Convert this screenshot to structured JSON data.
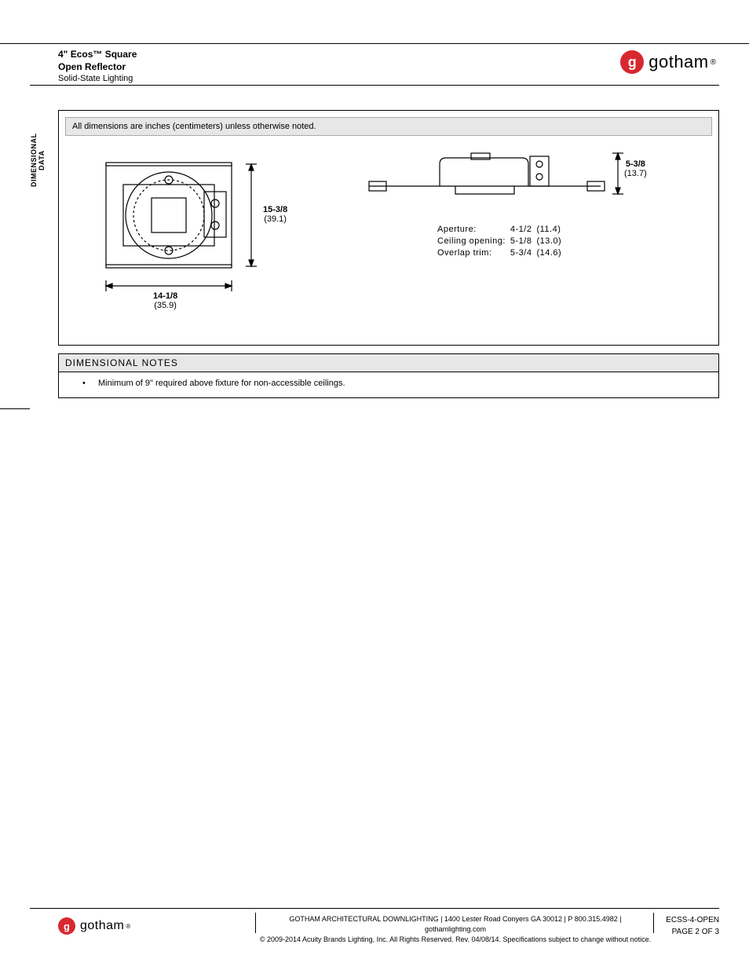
{
  "header": {
    "line1": "4\" Ecos™ Square",
    "line2": "Open Reflector",
    "line3": "Solid-State Lighting"
  },
  "brand": {
    "name": "gotham",
    "reg": "®"
  },
  "side_tab": "DIMENSIONAL DATA",
  "dim_note": "All dimensions are inches (centimeters) unless otherwise noted.",
  "left_dim": {
    "right_in": "15-3/8",
    "right_cm": "(39.1)",
    "bottom_in": "14-1/8",
    "bottom_cm": "(35.9)"
  },
  "right_dim": {
    "right_in": "5-3/8",
    "right_cm": "(13.7)"
  },
  "spec_table": {
    "rows": [
      {
        "label": "Aperture:",
        "in": "4-1/2",
        "cm": "(11.4)"
      },
      {
        "label": "Ceiling opening:",
        "in": "5-1/8",
        "cm": "(13.0)"
      },
      {
        "label": "Overlap trim:",
        "in": "5-3/4",
        "cm": "(14.6)"
      }
    ]
  },
  "notes": {
    "heading": "DIMENSIONAL NOTES",
    "items": [
      "Minimum of 9\" required above fixture for non-accessible ceilings."
    ]
  },
  "footer": {
    "line1": "GOTHAM ARCHITECTURAL DOWNLIGHTING  |  1400 Lester Road Conyers GA 30012  |  P 800.315.4982  |  gothamlighting.com",
    "line2": "© 2009-2014 Acuity Brands Lighting, Inc. All Rights Reserved. Rev. 04/08/14. Specifications subject to change without notice.",
    "code": "ECSS-4-OPEN",
    "page": "PAGE 2 OF 3"
  }
}
